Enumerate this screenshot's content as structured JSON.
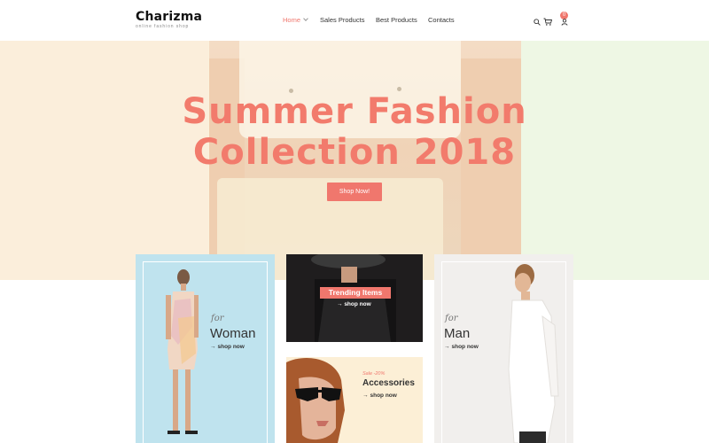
{
  "header": {
    "logo": {
      "name": "Charizma",
      "tagline": "online fashion shop"
    },
    "nav": [
      {
        "label": "Home",
        "active": true,
        "has_dropdown": true
      },
      {
        "label": "Sales Products"
      },
      {
        "label": "Best Products"
      },
      {
        "label": "Contacts"
      }
    ],
    "icons": [
      "search-icon",
      "cart-icon",
      "user-icon"
    ],
    "cart_count": "0"
  },
  "hero": {
    "title_line1": "Summer Fashion",
    "title_line2": "Collection 2018",
    "button_label": "Shop Now!"
  },
  "cards": {
    "woman": {
      "for": "for",
      "title": "Woman",
      "link": "shop now"
    },
    "trending": {
      "title": "Trending Items",
      "link": "shop now"
    },
    "accessories": {
      "sale": "Sale -20%",
      "title": "Accessories",
      "link": "shop now"
    },
    "man": {
      "for": "for",
      "title": "Man",
      "link": "shop now"
    }
  },
  "colors": {
    "accent": "#f0776d",
    "hero_bg": "#fbf1dc",
    "woman_card_bg": "#bfe3ee",
    "man_card_bg": "#f1efed"
  }
}
